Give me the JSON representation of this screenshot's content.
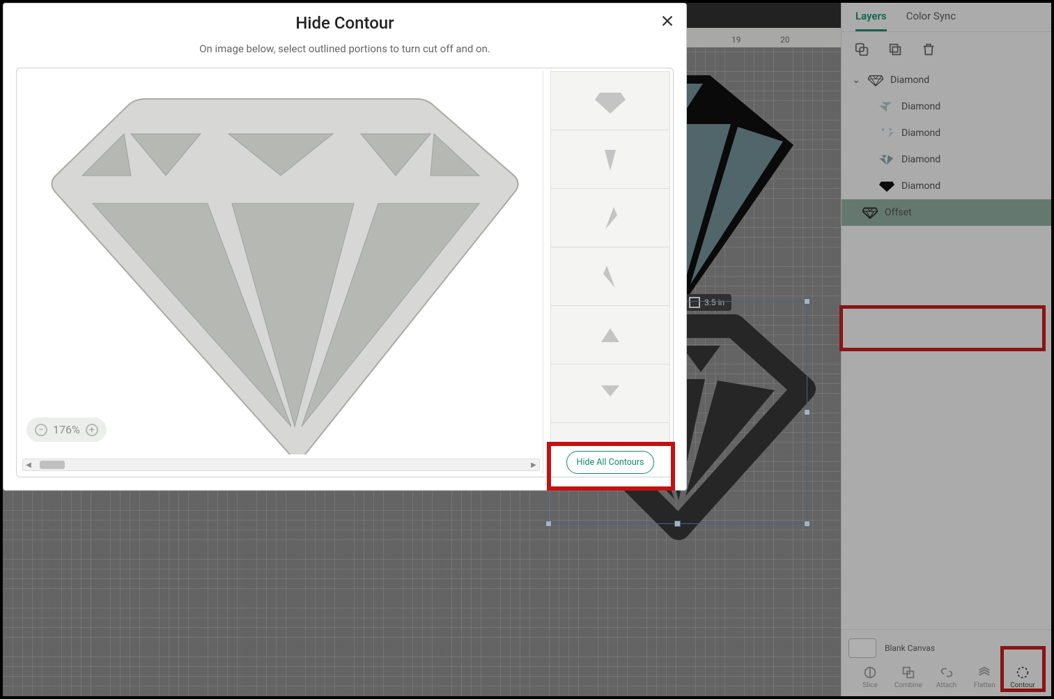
{
  "modal": {
    "title": "Hide Contour",
    "subtitle": "On image below, select outlined portions to turn cut off and on.",
    "zoom_label": "176%",
    "hide_all_label": "Hide All Contours"
  },
  "ruler": {
    "r19": "19",
    "r20": "20"
  },
  "size_badge": {
    "label": "3.5 in"
  },
  "panel": {
    "tab_layers": "Layers",
    "tab_colorsync": "Color Sync"
  },
  "layers": {
    "parent": "Diamond",
    "c1": "Diamond",
    "c2": "Diamond",
    "c3": "Diamond",
    "c4": "Diamond",
    "offset": "Offset"
  },
  "footer": {
    "blank": "Blank Canvas",
    "slice": "Slice",
    "combine": "Combine",
    "attach": "Attach",
    "flatten": "Flatten",
    "contour": "Contour"
  },
  "colors": {
    "accent": "#0f8a6b",
    "highlight": "#c31111",
    "diamond_fill": "#6c8e95",
    "diamond_outline": "#000000",
    "offset_shape": "#2c2c2c",
    "modal_shape_light": "#d7d8d6",
    "modal_shape_inner": "#b6b8b4"
  },
  "contour_shapes": [
    "top-gem",
    "tri-down",
    "slash-left",
    "slash-right",
    "tri-up",
    "tri-down-2"
  ]
}
